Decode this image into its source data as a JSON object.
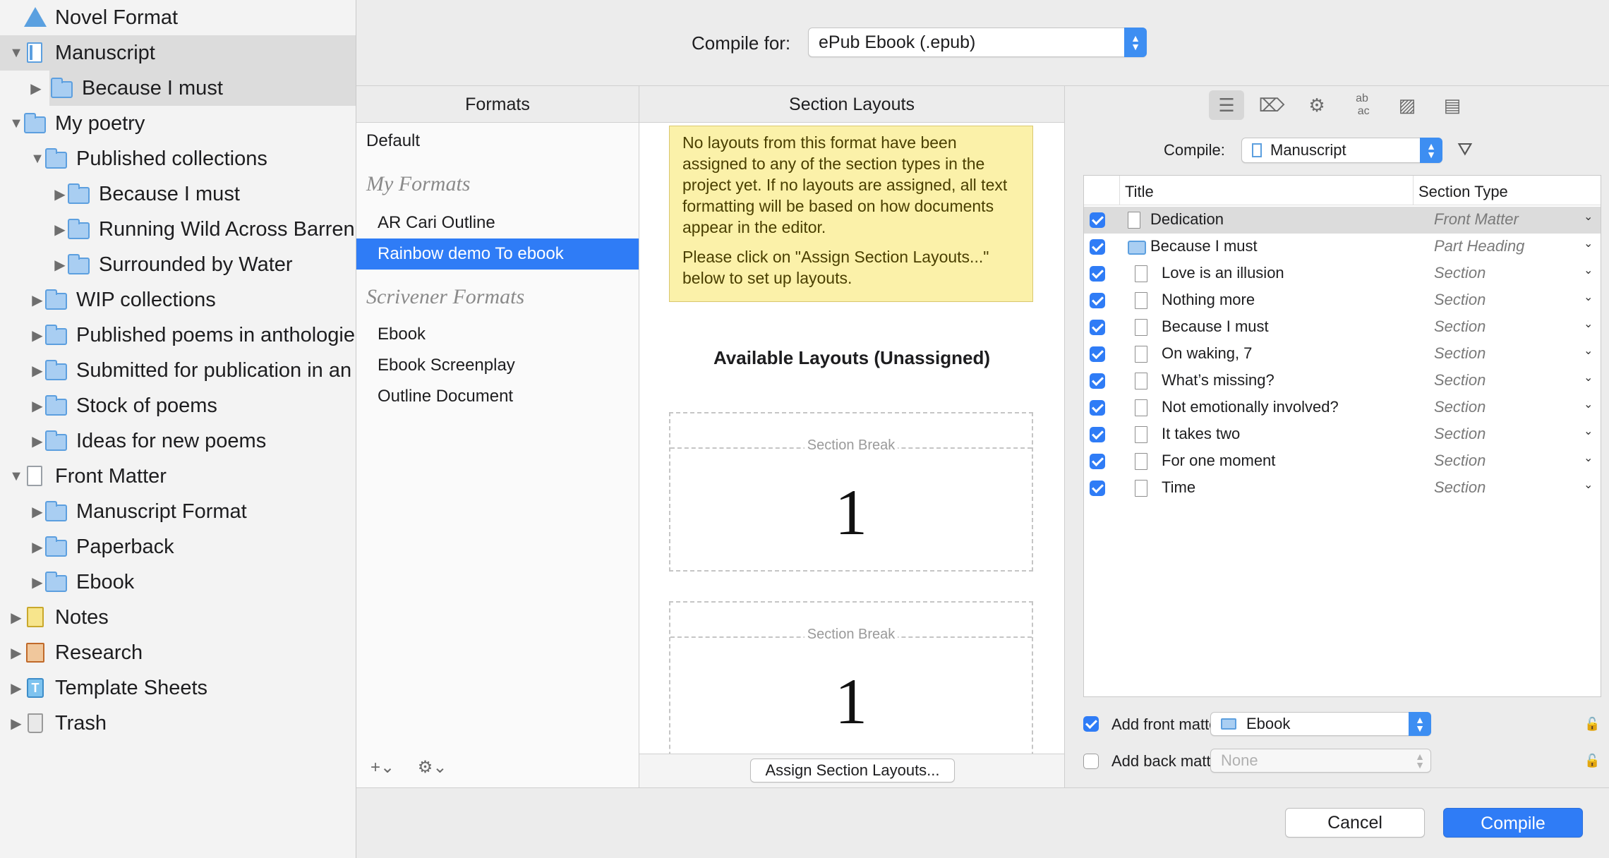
{
  "binder": {
    "items": [
      {
        "label": "Novel Format"
      },
      {
        "label": "Manuscript"
      },
      {
        "label": "Because I must"
      },
      {
        "label": "My poetry"
      },
      {
        "label": "Published collections"
      },
      {
        "label": "Because I must"
      },
      {
        "label": "Running Wild Across Barren"
      },
      {
        "label": "Surrounded by Water"
      },
      {
        "label": "WIP collections"
      },
      {
        "label": "Published poems in anthologie"
      },
      {
        "label": "Submitted for publication in an"
      },
      {
        "label": "Stock of poems"
      },
      {
        "label": "Ideas for new poems"
      },
      {
        "label": "Front Matter"
      },
      {
        "label": "Manuscript Format"
      },
      {
        "label": "Paperback"
      },
      {
        "label": "Ebook"
      },
      {
        "label": "Notes"
      },
      {
        "label": "Research"
      },
      {
        "label": "Template Sheets"
      },
      {
        "label": "Trash"
      }
    ]
  },
  "compile_for": {
    "label": "Compile for:",
    "value": "ePub Ebook (.epub)"
  },
  "formats": {
    "header": "Formats",
    "default": "Default",
    "my_formats_heading": "My Formats",
    "my_formats": [
      "AR Cari Outline",
      "Rainbow demo To ebook"
    ],
    "scrivener_heading": "Scrivener Formats",
    "scrivener_formats": [
      "Ebook",
      "Ebook Screenplay",
      "Outline Document"
    ],
    "add_icon": "+⌄",
    "gear_icon": "⚙⌄"
  },
  "section_layouts": {
    "header": "Section Layouts",
    "note_p1": "No layouts from this format have been assigned to any of the section types in the project yet. If no layouts are assigned, all text formatting will be based on how documents appear in the editor.",
    "note_p2": "Please click on \"Assign Section Layouts...\" below to set up layouts.",
    "available_heading": "Available Layouts (Unassigned)",
    "layouts": [
      {
        "break_label": "Section Break",
        "number": "1"
      },
      {
        "break_label": "Section Break",
        "number": "1"
      }
    ],
    "assign_button": "Assign Section Layouts..."
  },
  "right_pane": {
    "toolbar_icons": [
      "list-icon",
      "label-icon",
      "gear-icon",
      "replace-icon",
      "cover-icon",
      "metadata-icon"
    ],
    "compile_label": "Compile:",
    "compile_value": "Manuscript",
    "table": {
      "col_title": "Title",
      "col_type": "Section Type",
      "rows": [
        {
          "title": "Dedication",
          "type": "Front Matter"
        },
        {
          "title": "Because I must",
          "type": "Part Heading"
        },
        {
          "title": "Love is an illusion",
          "type": "Section"
        },
        {
          "title": "Nothing more",
          "type": "Section"
        },
        {
          "title": "Because I must",
          "type": "Section"
        },
        {
          "title": "On waking, 7",
          "type": "Section"
        },
        {
          "title": "What’s missing?",
          "type": "Section"
        },
        {
          "title": "Not emotionally involved?",
          "type": "Section"
        },
        {
          "title": "It takes two",
          "type": "Section"
        },
        {
          "title": "For one moment",
          "type": "Section"
        },
        {
          "title": "Time",
          "type": "Section"
        }
      ]
    },
    "front_matter_label": "Add front matter:",
    "front_matter_value": "Ebook",
    "back_matter_label": "Add back matter:",
    "back_matter_value": "None"
  },
  "buttons": {
    "cancel": "Cancel",
    "compile": "Compile"
  },
  "colors": {
    "accent": "#2f7cf6",
    "note_bg": "#fbf1a9",
    "folder": "#a9cef2"
  }
}
